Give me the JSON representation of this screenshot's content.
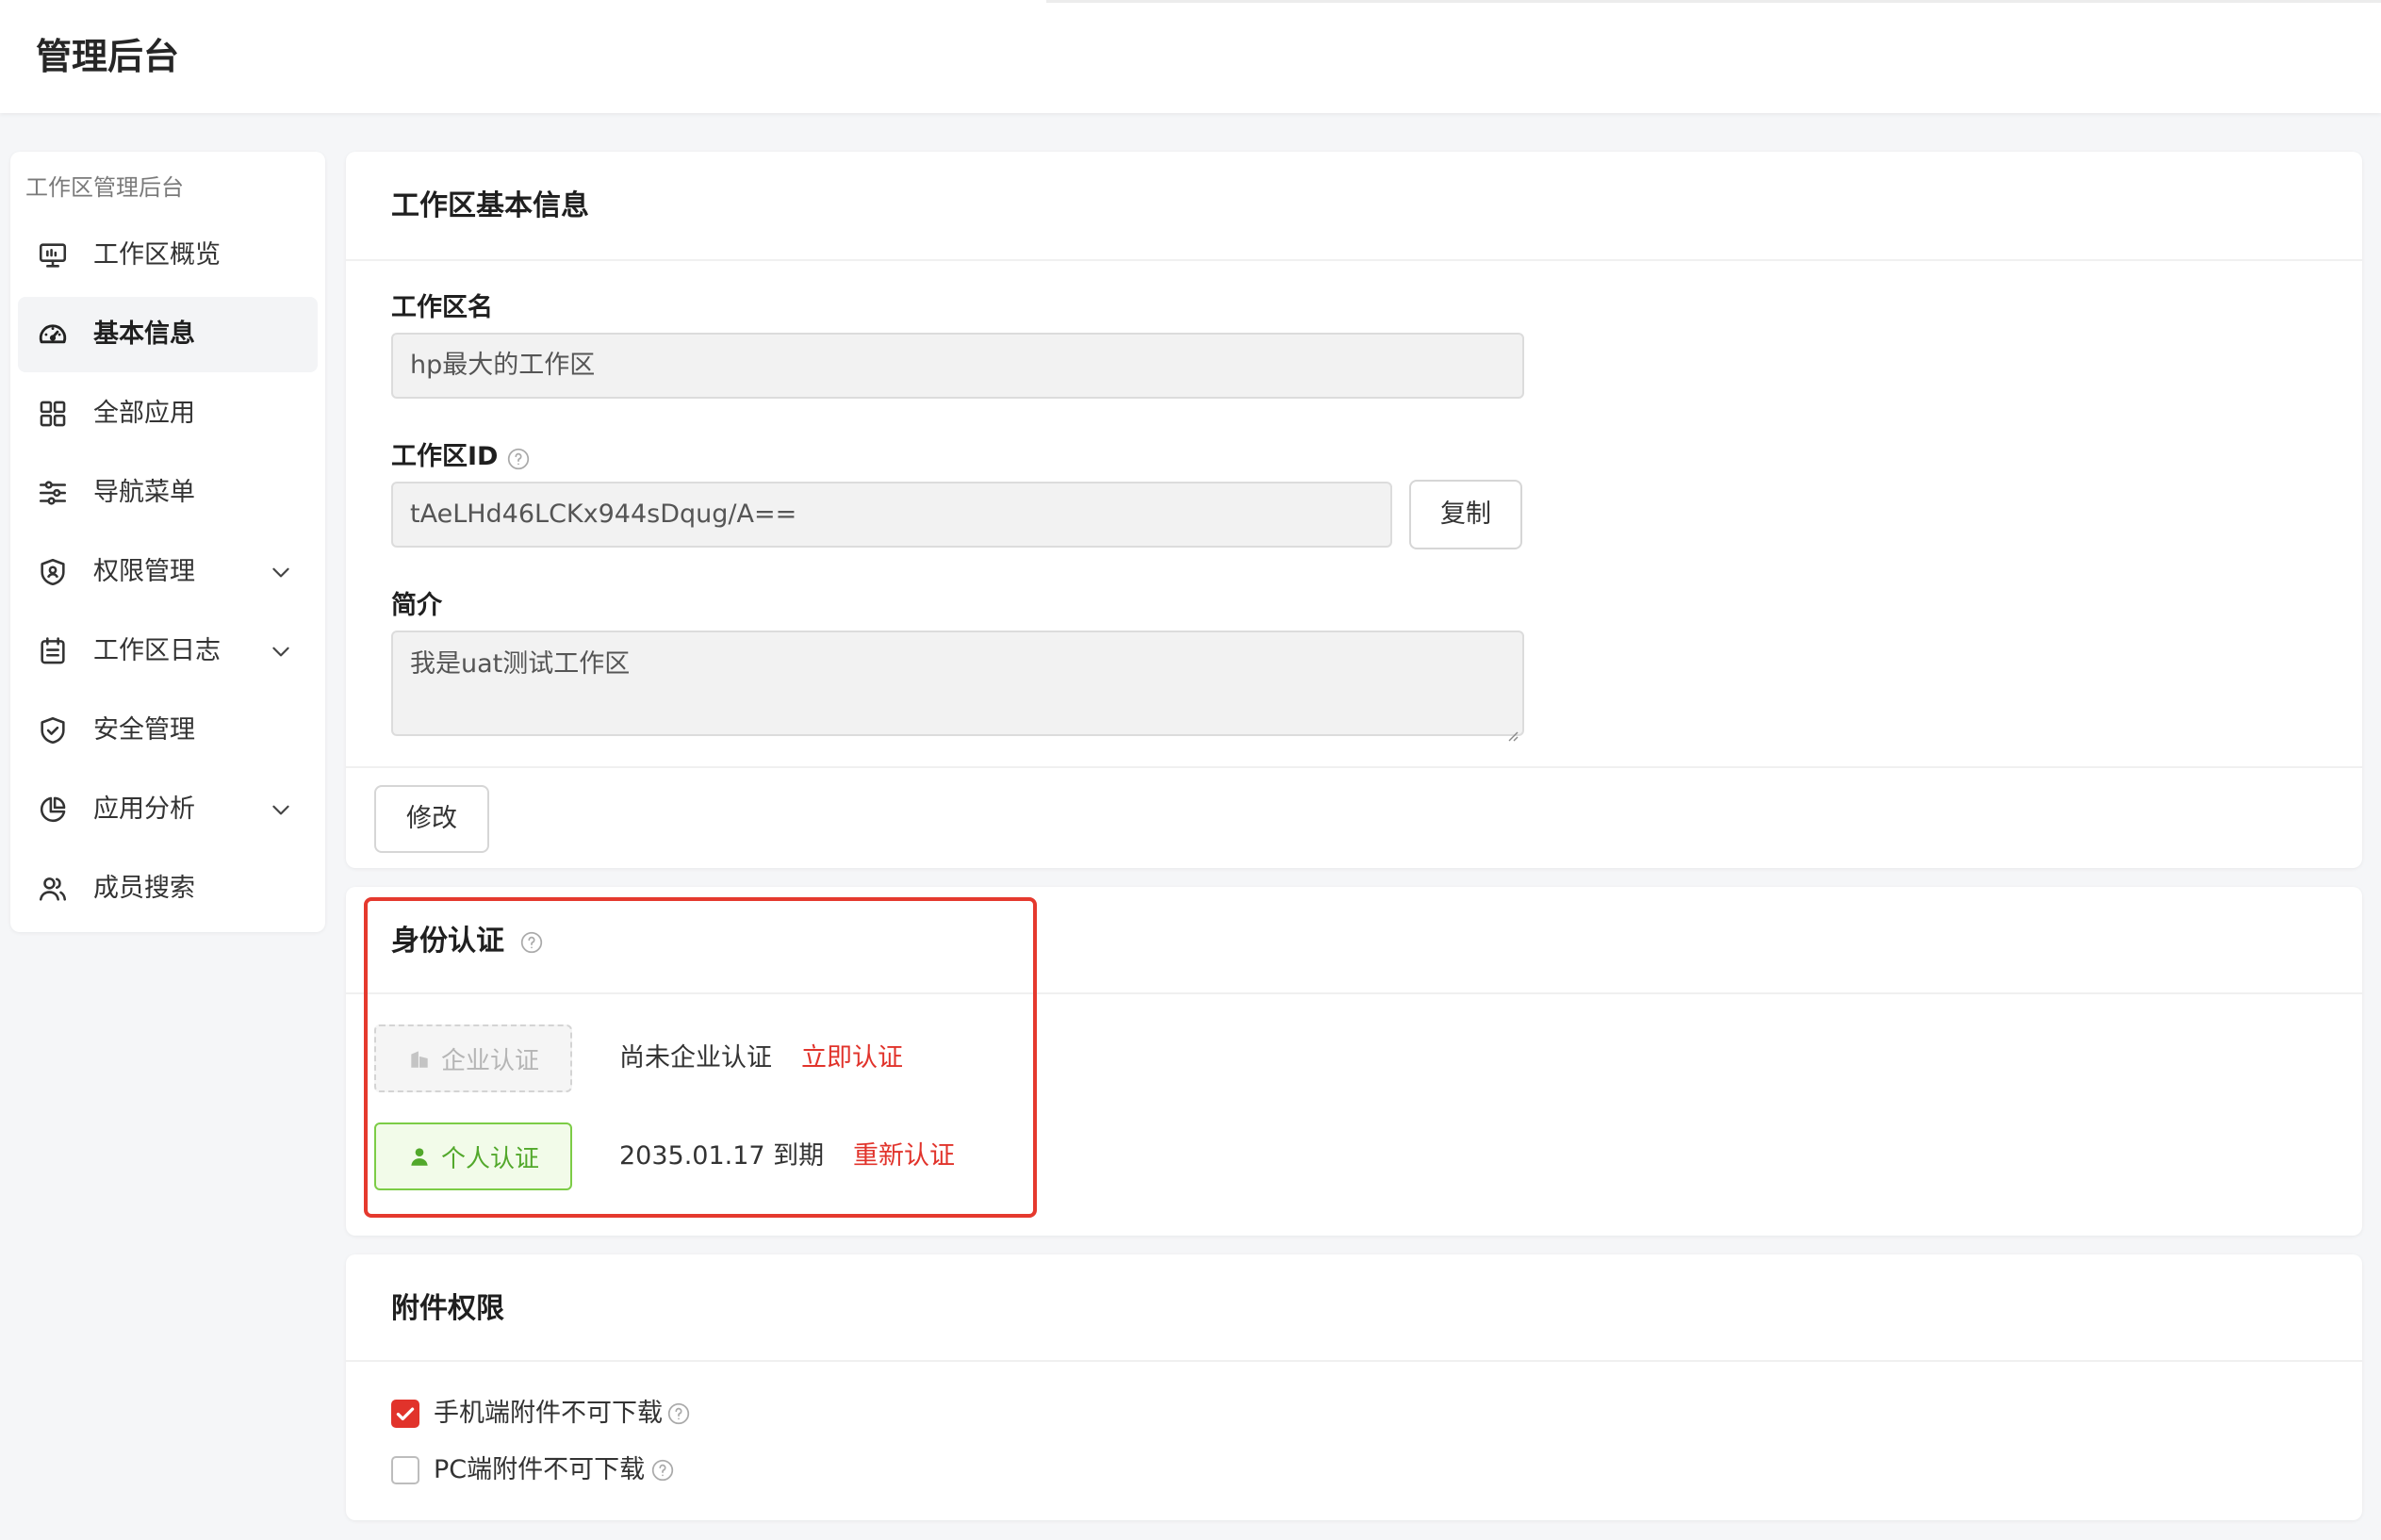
{
  "header": {
    "title": "管理后台"
  },
  "sidebar": {
    "heading": "工作区管理后台",
    "items": [
      {
        "label": "工作区概览",
        "icon": "monitor-icon",
        "active": false,
        "expandable": false
      },
      {
        "label": "基本信息",
        "icon": "dashboard-icon",
        "active": true,
        "expandable": false
      },
      {
        "label": "全部应用",
        "icon": "apps-grid-icon",
        "active": false,
        "expandable": false
      },
      {
        "label": "导航菜单",
        "icon": "sliders-icon",
        "active": false,
        "expandable": false
      },
      {
        "label": "权限管理",
        "icon": "shield-user-icon",
        "active": false,
        "expandable": true
      },
      {
        "label": "工作区日志",
        "icon": "calendar-log-icon",
        "active": false,
        "expandable": true
      },
      {
        "label": "安全管理",
        "icon": "shield-check-icon",
        "active": false,
        "expandable": false
      },
      {
        "label": "应用分析",
        "icon": "pie-chart-icon",
        "active": false,
        "expandable": true
      },
      {
        "label": "成员搜索",
        "icon": "users-icon",
        "active": false,
        "expandable": false
      }
    ]
  },
  "basic_info": {
    "title": "工作区基本信息",
    "name_label": "工作区名",
    "name_value": "hp最大的工作区",
    "id_label": "工作区ID",
    "id_value": "tAeLHd46LCKx944sDqug/A==",
    "copy_button": "复制",
    "intro_label": "简介",
    "intro_value": "我是uat测试工作区",
    "edit_button": "修改"
  },
  "identity": {
    "title": "身份认证",
    "enterprise": {
      "button": "企业认证",
      "status": "尚未企业认证",
      "action": "立即认证"
    },
    "personal": {
      "button": "个人认证",
      "status": "2035.01.17 到期",
      "action": "重新认证"
    }
  },
  "attachments": {
    "title": "附件权限",
    "options": [
      {
        "label": "手机端附件不可下载",
        "checked": true
      },
      {
        "label": "PC端附件不可下载",
        "checked": false
      }
    ]
  },
  "colors": {
    "accent_red": "#e1332b",
    "highlight_border": "#e5392e",
    "success_green": "#52a82b"
  }
}
